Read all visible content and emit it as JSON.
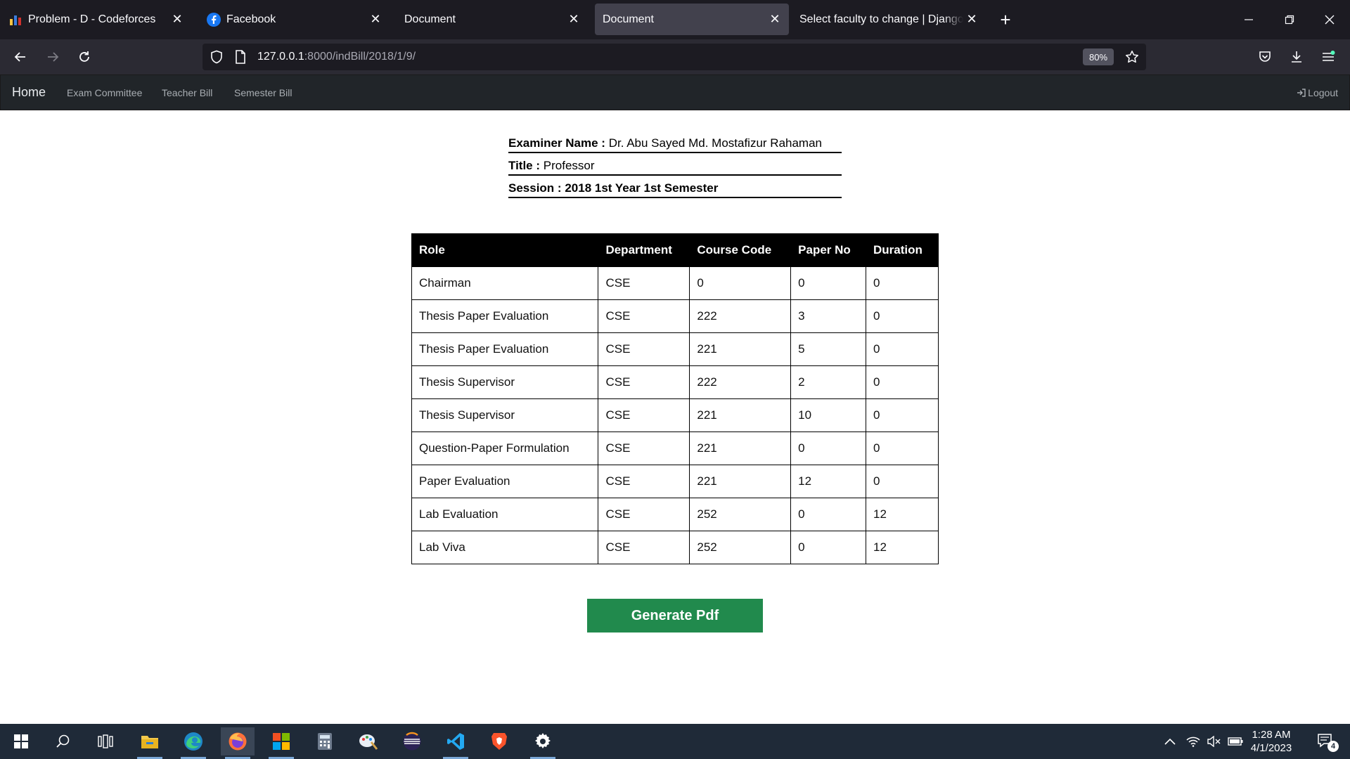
{
  "browser": {
    "tabs": [
      {
        "title": "Problem - D - Codeforces",
        "favicon": "codeforces-icon",
        "active": false
      },
      {
        "title": "Facebook",
        "favicon": "facebook-icon",
        "active": false
      },
      {
        "title": "Document",
        "favicon": "",
        "active": false
      },
      {
        "title": "Document",
        "favicon": "",
        "active": true
      },
      {
        "title": "Select faculty to change | Django si",
        "favicon": "",
        "active": false
      }
    ],
    "url_host": "127.0.0.1",
    "url_rest": ":8000/indBill/2018/1/9/",
    "zoom": "80%"
  },
  "site_nav": {
    "brand": "Home",
    "links": [
      "Exam Committee",
      "Teacher Bill",
      "Semester Bill"
    ],
    "logout": "Logout"
  },
  "info": {
    "examiner_label": "Examiner Name :",
    "examiner_value": "Dr. Abu Sayed Md. Mostafizur Rahaman",
    "title_label": "Title :",
    "title_value": "Professor",
    "session_label": "Session :",
    "session_value": "2018 1st Year 1st Semester"
  },
  "table": {
    "headers": [
      "Role",
      "Department",
      "Course Code",
      "Paper No",
      "Duration"
    ],
    "rows": [
      [
        "Chairman",
        "CSE",
        "0",
        "0",
        "0"
      ],
      [
        "Thesis Paper Evaluation",
        "CSE",
        "222",
        "3",
        "0"
      ],
      [
        "Thesis Paper Evaluation",
        "CSE",
        "221",
        "5",
        "0"
      ],
      [
        "Thesis Supervisor",
        "CSE",
        "222",
        "2",
        "0"
      ],
      [
        "Thesis Supervisor",
        "CSE",
        "221",
        "10",
        "0"
      ],
      [
        "Question-Paper Formulation",
        "CSE",
        "221",
        "0",
        "0"
      ],
      [
        "Paper Evaluation",
        "CSE",
        "221",
        "12",
        "0"
      ],
      [
        "Lab Evaluation",
        "CSE",
        "252",
        "0",
        "12"
      ],
      [
        "Lab Viva",
        "CSE",
        "252",
        "0",
        "12"
      ]
    ]
  },
  "generate_button": "Generate Pdf",
  "taskbar": {
    "time": "1:28 AM",
    "date": "4/1/2023",
    "notifications": "4"
  },
  "colors": {
    "tab_strip": "#1c1b22",
    "toolbar": "#2b2a33",
    "site_nav": "#212529",
    "table_header": "#000000",
    "generate_button": "#218a4d",
    "taskbar": "#1f2a38"
  }
}
